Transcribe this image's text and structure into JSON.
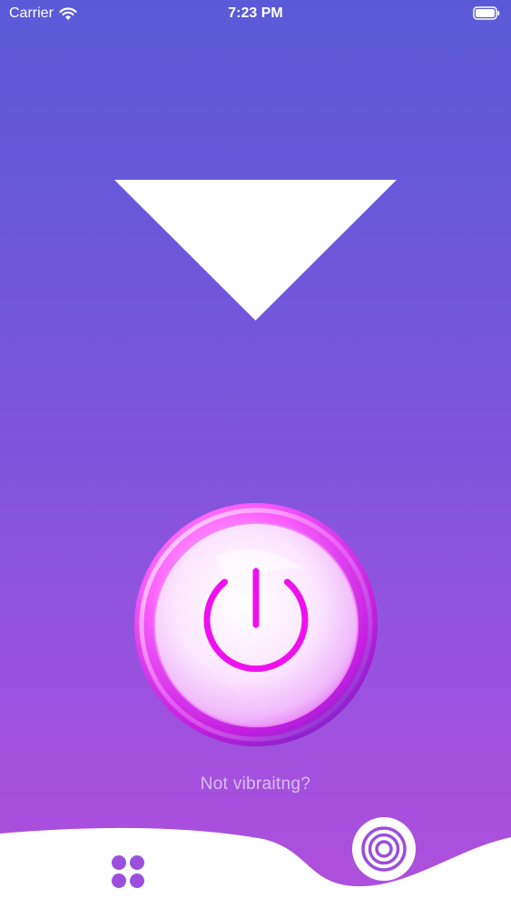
{
  "status_bar": {
    "carrier": "Carrier",
    "time": "7:23 PM"
  },
  "main": {
    "help_link": "Not vibraitng?"
  },
  "icons": {
    "wifi": "wifi-icon",
    "battery": "battery-icon",
    "triangle": "down-triangle-icon",
    "power": "power-icon",
    "grid": "grid-dots-icon",
    "vibrate": "concentric-circles-icon"
  },
  "colors": {
    "accent": "#ee11ee",
    "icon_purple": "#9b4fdc",
    "bg_top": "#5a5ad8",
    "bg_bottom": "#b04fdc"
  }
}
